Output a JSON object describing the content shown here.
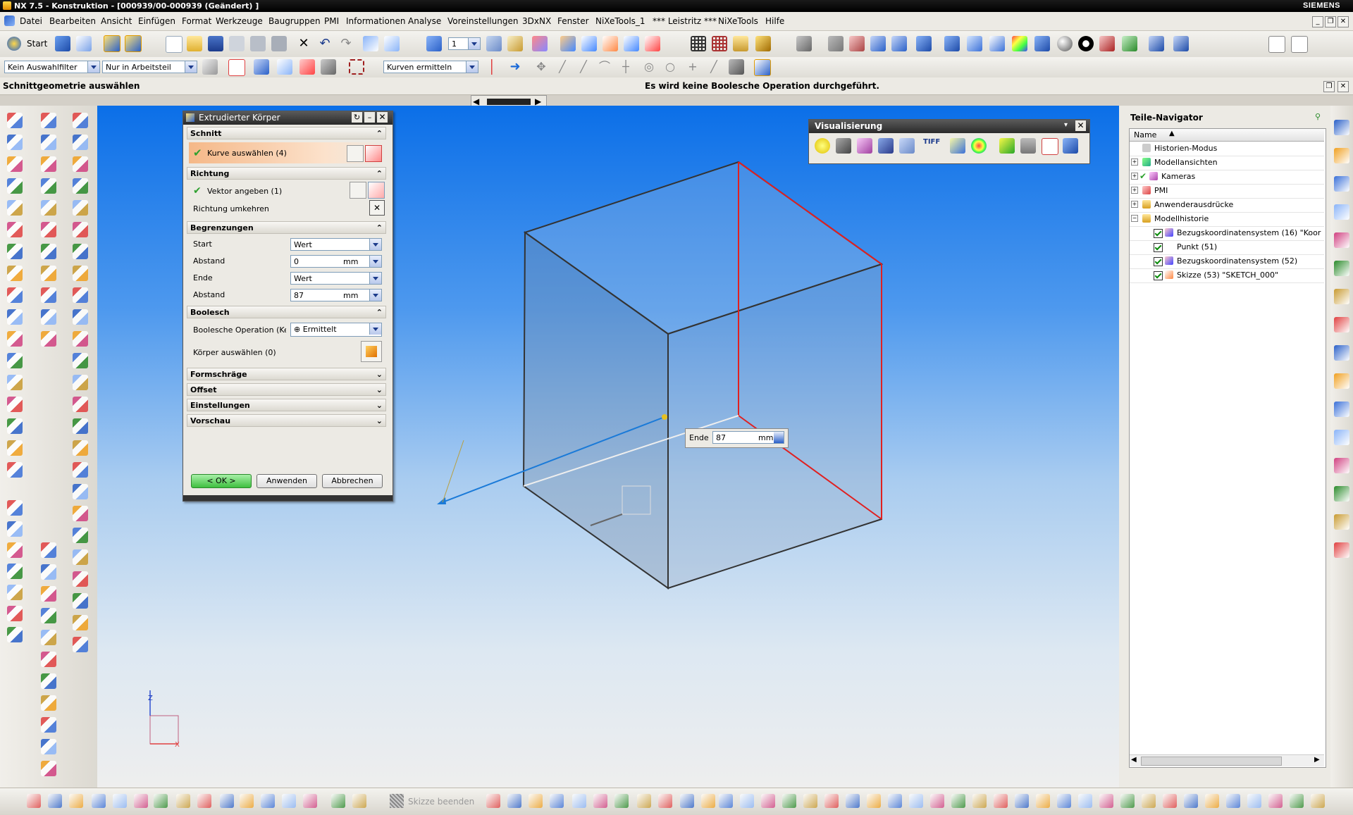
{
  "titlebar": {
    "title": "NX 7.5 - Konstruktion - [000939/00-000939 (Geändert) ]",
    "brand": "SIEMENS"
  },
  "menu": {
    "items": [
      "Datei",
      "Bearbeiten",
      "Ansicht",
      "Einfügen",
      "Format",
      "Werkzeuge",
      "Baugruppen",
      "PMI",
      "Informationen",
      "Analyse",
      "Voreinstellungen",
      "3DxNX",
      "Fenster",
      "NiXeTools_1",
      "*** Leistritz ***",
      "NiXeTools",
      "Hilfe"
    ]
  },
  "toolbar": {
    "start_label": "Start",
    "layer_value": "1"
  },
  "selection_bar": {
    "filter_value": "Kein Auswahlfilter",
    "scope_value": "Nur in Arbeitsteil",
    "curve_rule_value": "Kurven ermitteln"
  },
  "status": {
    "prompt": "Schnittgeometrie auswählen",
    "message": "Es wird keine Boolesche Operation durchgeführt."
  },
  "dialog": {
    "title": "Extrudierter Körper",
    "sections": {
      "schnitt": "Schnitt",
      "richtung": "Richtung",
      "begrenzungen": "Begrenzungen",
      "boolesch": "Boolesch",
      "formschraege": "Formschräge",
      "offset": "Offset",
      "einstellungen": "Einstellungen",
      "vorschau": "Vorschau"
    },
    "select_curve": "Kurve auswählen (4)",
    "specify_vector": "Vektor angeben (1)",
    "reverse_direction": "Richtung umkehren",
    "start_label": "Start",
    "start_value": "Wert",
    "start_distance_label": "Abstand",
    "start_distance_value": "0",
    "end_label": "Ende",
    "end_value": "Wert",
    "end_distance_label": "Abstand",
    "end_distance_value": "87",
    "unit": "mm",
    "boolean_label": "Boolesche Operation (Ke",
    "boolean_value": "Ermittelt",
    "select_body": "Körper auswählen (0)",
    "ok": "< OK >",
    "apply": "Anwenden",
    "cancel": "Abbrechen"
  },
  "visualization": {
    "title": "Visualisierung",
    "tiff_label": "TIFF"
  },
  "viewport": {
    "onscreen_label": "Ende",
    "onscreen_value": "87",
    "onscreen_unit": "mm",
    "axis_z": "Z",
    "axis_x": "X"
  },
  "navigator": {
    "title": "Teile-Navigator",
    "column": "Name",
    "items": [
      {
        "label": "Historien-Modus"
      },
      {
        "label": "Modellansichten"
      },
      {
        "label": "Kameras"
      },
      {
        "label": "PMI"
      },
      {
        "label": "Anwenderausdrücke"
      },
      {
        "label": "Modellhistorie"
      },
      {
        "label": "Bezugskoordinatensystem (16) \"Koor"
      },
      {
        "label": "Punkt (51)"
      },
      {
        "label": "Bezugskoordinatensystem (52)"
      },
      {
        "label": "Skizze (53) \"SKETCH_000\""
      }
    ]
  },
  "bottombar": {
    "finish_sketch": "Skizze beenden"
  },
  "colors": {
    "accent_green": "#3fbf3f",
    "selected_orange": "#f0a868",
    "edge_red": "#e02020",
    "vector_blue": "#1a7ad8"
  }
}
